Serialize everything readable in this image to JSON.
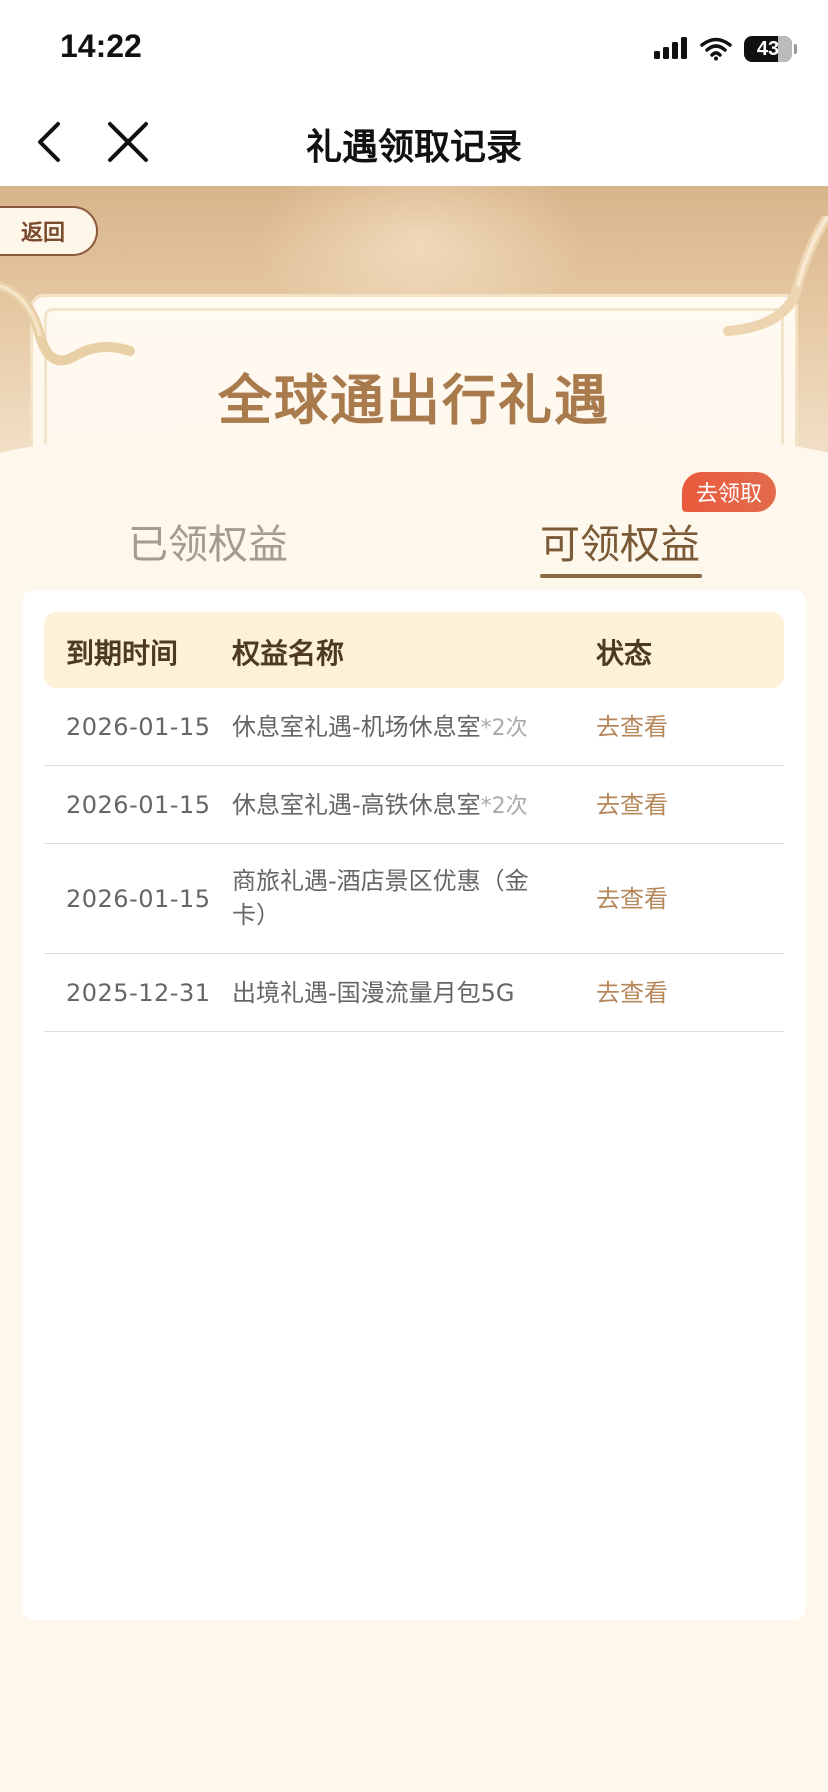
{
  "status_bar": {
    "time": "14:22",
    "battery": "43"
  },
  "nav": {
    "title": "礼遇领取记录"
  },
  "banner": {
    "back_label": "返回",
    "title": "全球通出行礼遇"
  },
  "tabs": [
    {
      "label": "已领权益",
      "active": false
    },
    {
      "label": "可领权益",
      "active": true
    }
  ],
  "tab_badge": "去领取",
  "table": {
    "headers": {
      "date": "到期时间",
      "name": "权益名称",
      "status": "状态"
    },
    "rows": [
      {
        "date": "2026-01-15",
        "name": "休息室礼遇-机场休息室",
        "suffix": "*2次",
        "action": "去查看"
      },
      {
        "date": "2026-01-15",
        "name": "休息室礼遇-高铁休息室",
        "suffix": "*2次",
        "action": "去查看"
      },
      {
        "date": "2026-01-15",
        "name": "商旅礼遇-酒店景区优惠（金卡）",
        "suffix": "",
        "action": "去查看"
      },
      {
        "date": "2025-12-31",
        "name": "出境礼遇-国漫流量月包5G",
        "suffix": "",
        "action": "去查看"
      }
    ]
  },
  "colors": {
    "accent_gold": "#a87a4c",
    "action_text": "#b5875a",
    "badge_red": "#ea5a3c",
    "header_bg": "#fdf1d9"
  }
}
